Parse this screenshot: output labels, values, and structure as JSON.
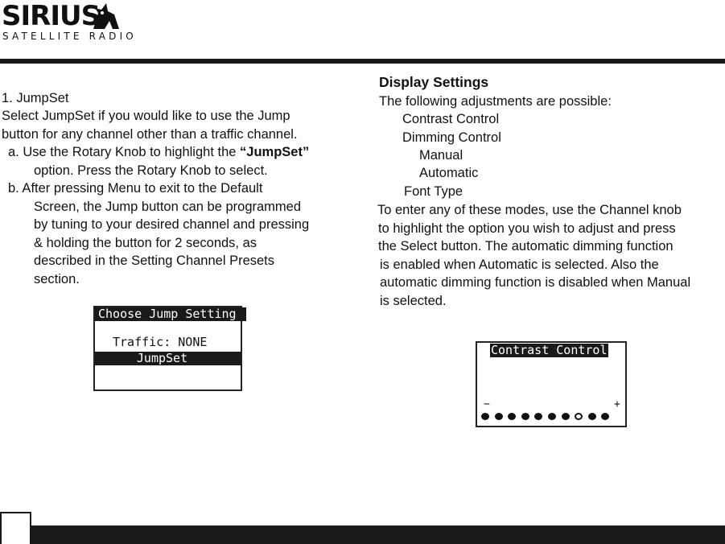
{
  "logo": {
    "word": "SIRIUS",
    "sub": "SATELLITE RADIO"
  },
  "left": {
    "lines": [
      "1. JumpSet",
      "Select JumpSet if you would like to use the Jump",
      "button for any channel other than a traffic channel.",
      "Press the Rotary Knob to select.",
      "b.  After pressing Menu to exit to the Default",
      "Screen, the Jump button can be programmed",
      "by tuning to your desired channel and pressing",
      "& holding the button for 2 seconds, as",
      "described in the Setting Channel Presets",
      "section."
    ],
    "a_prefix": "a. Use the Rotary Knob to highlight the ",
    "a_bold": "“JumpSet”",
    "a_cont": "option.  Press the Rotary Knob to select."
  },
  "lcd_jump": {
    "title": "Choose Jump Setting",
    "line1": "Traffic: NONE",
    "selected": "JumpSet"
  },
  "right": {
    "heading": "Display Settings",
    "intro": "The following adjustments are possible:",
    "items": [
      "Contrast Control",
      "Dimming Control",
      "Manual",
      "Automatic",
      "Font Type"
    ],
    "para": [
      "To enter any of these modes, use the Channel knob",
      "to highlight the option you wish to adjust and press",
      "the Select button. The automatic dimming function",
      "is enabled when Automatic is selected. Also the",
      "automatic dimming function is disabled when Manual",
      "is selected."
    ]
  },
  "lcd_contrast": {
    "title": "Contrast Control",
    "minus": "−",
    "plus": "+",
    "levels": 10,
    "current_level": 8
  }
}
